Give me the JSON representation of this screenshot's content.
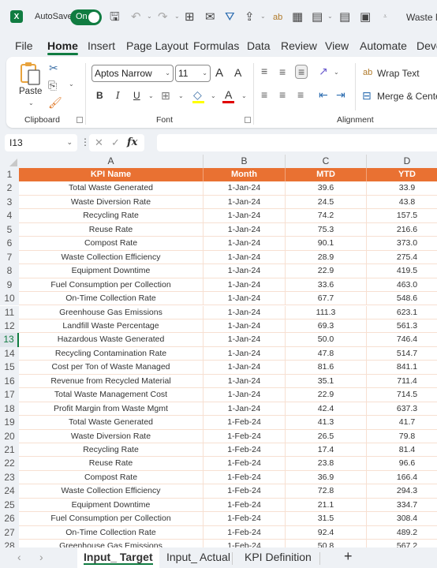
{
  "titlebar": {
    "app_icon": "X",
    "autosave_label": "AutoSave",
    "autosave_state": "On",
    "document_title": "Waste M",
    "qat_icons": [
      "save-sync-icon",
      "undo-icon",
      "redo-icon",
      "borders-icon",
      "email-icon",
      "filter-icon",
      "share-icon",
      "spelling-icon",
      "table-icon",
      "calculator-icon",
      "calculator-icon",
      "form-icon",
      "customize-icon"
    ]
  },
  "menu": {
    "tabs": [
      "File",
      "Home",
      "Insert",
      "Page Layout",
      "Formulas",
      "Data",
      "Review",
      "View",
      "Automate",
      "Deve"
    ],
    "active": "Home"
  },
  "ribbon": {
    "clipboard": {
      "label": "Clipboard",
      "paste_label": "Paste"
    },
    "font": {
      "label": "Font",
      "font_name": "Aptos Narrow",
      "font_size": "11",
      "bold": "B",
      "italic": "I",
      "underline": "U",
      "grow": "A",
      "shrink": "A",
      "fill_color": "#ffff00",
      "font_color": "#e00000"
    },
    "alignment": {
      "label": "Alignment",
      "wrap_text": "Wrap Text",
      "merge_center": "Merge & Center"
    }
  },
  "formula_bar": {
    "name_box": "I13",
    "fx": "fx",
    "formula": ""
  },
  "sheet": {
    "columns": [
      "A",
      "B",
      "C",
      "D"
    ],
    "header_color": "#e97132",
    "selected_row": 13,
    "rows": [
      [
        "KPI Name",
        "Month",
        "MTD",
        "YTD"
      ],
      [
        "Total Waste Generated",
        "1-Jan-24",
        "39.6",
        "33.9"
      ],
      [
        "Waste Diversion Rate",
        "1-Jan-24",
        "24.5",
        "43.8"
      ],
      [
        "Recycling Rate",
        "1-Jan-24",
        "74.2",
        "157.5"
      ],
      [
        "Reuse Rate",
        "1-Jan-24",
        "75.3",
        "216.6"
      ],
      [
        "Compost Rate",
        "1-Jan-24",
        "90.1",
        "373.0"
      ],
      [
        "Waste Collection Efficiency",
        "1-Jan-24",
        "28.9",
        "275.4"
      ],
      [
        "Equipment Downtime",
        "1-Jan-24",
        "22.9",
        "419.5"
      ],
      [
        "Fuel Consumption per Collection",
        "1-Jan-24",
        "33.6",
        "463.0"
      ],
      [
        "On-Time Collection Rate",
        "1-Jan-24",
        "67.7",
        "548.6"
      ],
      [
        "Greenhouse Gas Emissions",
        "1-Jan-24",
        "111.3",
        "623.1"
      ],
      [
        "Landfill Waste Percentage",
        "1-Jan-24",
        "69.3",
        "561.3"
      ],
      [
        "Hazardous Waste Generated",
        "1-Jan-24",
        "50.0",
        "746.4"
      ],
      [
        "Recycling Contamination Rate",
        "1-Jan-24",
        "47.8",
        "514.7"
      ],
      [
        "Cost per Ton of Waste Managed",
        "1-Jan-24",
        "81.6",
        "841.1"
      ],
      [
        "Revenue from Recycled Material",
        "1-Jan-24",
        "35.1",
        "711.4"
      ],
      [
        "Total Waste Management Cost",
        "1-Jan-24",
        "22.9",
        "714.5"
      ],
      [
        "Profit Margin from Waste Mgmt",
        "1-Jan-24",
        "42.4",
        "637.3"
      ],
      [
        "Total Waste Generated",
        "1-Feb-24",
        "41.3",
        "41.7"
      ],
      [
        "Waste Diversion Rate",
        "1-Feb-24",
        "26.5",
        "79.8"
      ],
      [
        "Recycling Rate",
        "1-Feb-24",
        "17.4",
        "81.4"
      ],
      [
        "Reuse Rate",
        "1-Feb-24",
        "23.8",
        "96.6"
      ],
      [
        "Compost Rate",
        "1-Feb-24",
        "36.9",
        "166.4"
      ],
      [
        "Waste Collection Efficiency",
        "1-Feb-24",
        "72.8",
        "294.3"
      ],
      [
        "Equipment Downtime",
        "1-Feb-24",
        "21.1",
        "334.7"
      ],
      [
        "Fuel Consumption per Collection",
        "1-Feb-24",
        "31.5",
        "308.4"
      ],
      [
        "On-Time Collection Rate",
        "1-Feb-24",
        "92.4",
        "489.2"
      ],
      [
        "Greenhouse Gas Emissions",
        "1-Feb-24",
        "50.8",
        "567.2"
      ]
    ]
  },
  "sheet_tabs": {
    "tabs": [
      "Input_ Target",
      "Input_ Actual",
      "KPI Definition"
    ],
    "active": "Input_ Target",
    "add_label": "+"
  }
}
